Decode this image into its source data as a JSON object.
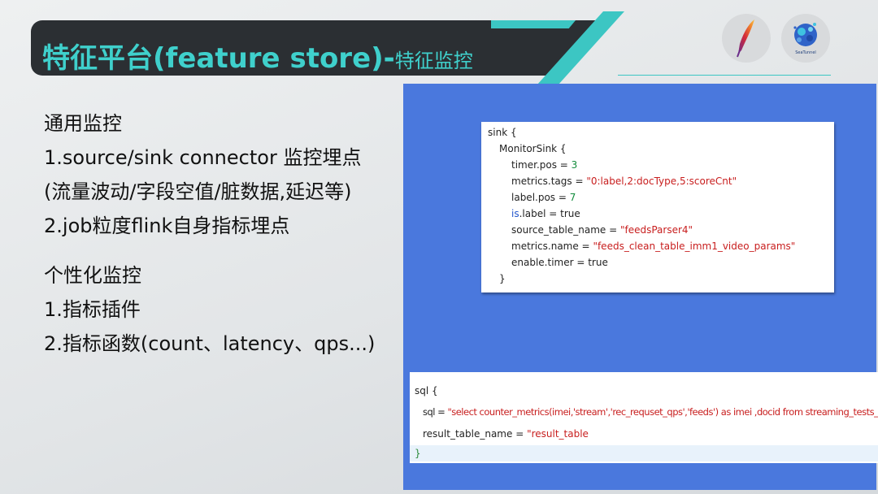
{
  "header": {
    "title_main": "特征平台(feature store)-",
    "title_sub": "特征监控"
  },
  "logos": [
    "feather-logo",
    "seatunnel-logo"
  ],
  "logo_seatunnel_text": "SeaTunnel",
  "section1": {
    "heading": "通用监控",
    "items": [
      "1.source/sink connector 监控埋点",
      "(流量波动/字段空值/脏数据,延迟等)",
      "2.job粒度flink自身指标埋点"
    ]
  },
  "section2": {
    "heading": "个性化监控",
    "items": [
      "1.指标插件",
      "2.指标函数(count、latency、qps...)"
    ]
  },
  "code_sink": {
    "l1": "sink {",
    "l2": "MonitorSink {",
    "l3_key": "timer.pos = ",
    "l3_val": "3",
    "l4_key": "metrics.tags = ",
    "l4_val": "\"0:label,2:docType,5:scoreCnt\"",
    "l5_key": "label.pos = ",
    "l5_val": "7",
    "l6_key_a": "is",
    "l6_key_b": ".label = true",
    "l7_key": "source_table_name = ",
    "l7_val": "\"feedsParser4\"",
    "l8_key": "metrics.name = ",
    "l8_val": "\"feeds_clean_table_imm1_video_params\"",
    "l9": "enable.timer = true",
    "l10": "}"
  },
  "code_sql": {
    "l1": "sql {",
    "l2_key": "sql = ",
    "l2_val": "\"select counter_metrics(imei,'stream','rec_requset_qps','feeds') as imei ,docid from streaming_tests_table\"",
    "l3_key": "result_table_name = ",
    "l3_val": "\"result_table",
    "l4": "}"
  },
  "colors": {
    "accent": "#3cc6c3",
    "title_bar": "#2b2f33",
    "panel_blue": "#4a78dd",
    "string_red": "#c81e1e",
    "number_green": "#128c3c"
  }
}
